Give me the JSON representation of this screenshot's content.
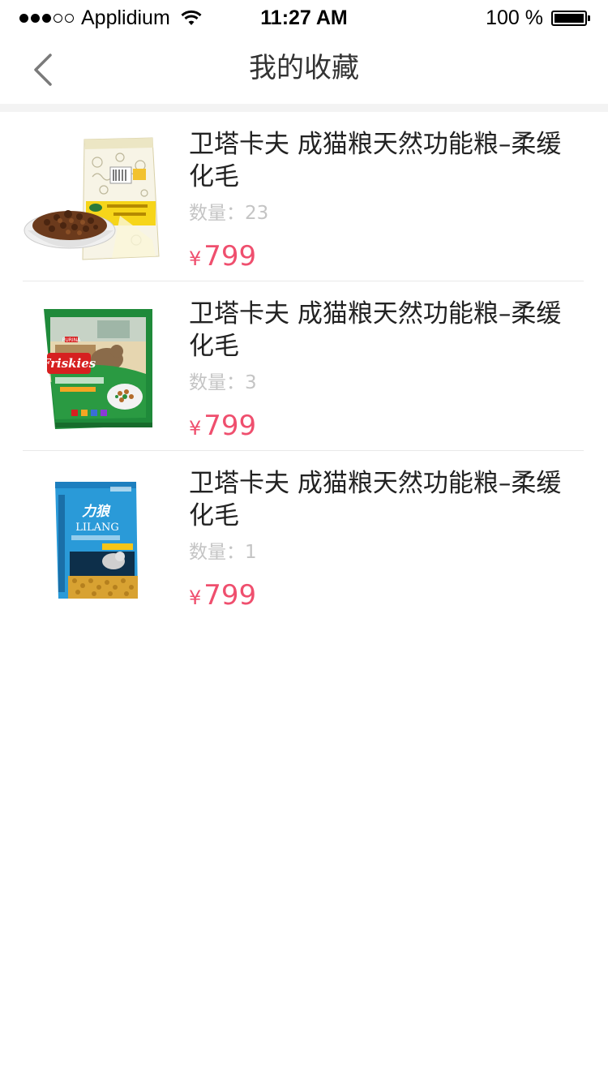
{
  "status_bar": {
    "carrier": "Applidium",
    "time": "11:27 AM",
    "battery": "100 %",
    "battery_level": 1.0,
    "signal_bars_filled": 3,
    "signal_bars_total": 5
  },
  "nav": {
    "title": "我的收藏",
    "back_icon": "chevron-left-icon"
  },
  "colors": {
    "price": "#ef4f6e",
    "muted": "#c4c4c4",
    "divider": "#e9e9e9",
    "band": "#f3f3f3"
  },
  "items": [
    {
      "name": "卫塔卡夫 成猫粮天然功能粮–柔缓化毛",
      "quantity_label": "数量：",
      "quantity": "23",
      "currency": "¥",
      "price": "799",
      "image": "cat-food-bag-white"
    },
    {
      "name": "卫塔卡夫 成猫粮天然功能粮–柔缓化毛",
      "quantity_label": "数量：",
      "quantity": "3",
      "currency": "¥",
      "price": "799",
      "image": "friskies-cat-food-bag"
    },
    {
      "name": "卫塔卡夫 成猫粮天然功能粮–柔缓化毛",
      "quantity_label": "数量：",
      "quantity": "1",
      "currency": "¥",
      "price": "799",
      "image": "lilang-cat-food-bag"
    }
  ],
  "images": {
    "friskies_logo": "Friskies",
    "lilang_logo": "LILANG",
    "lilang_cn": "力狼",
    "purina": "PURINA"
  }
}
